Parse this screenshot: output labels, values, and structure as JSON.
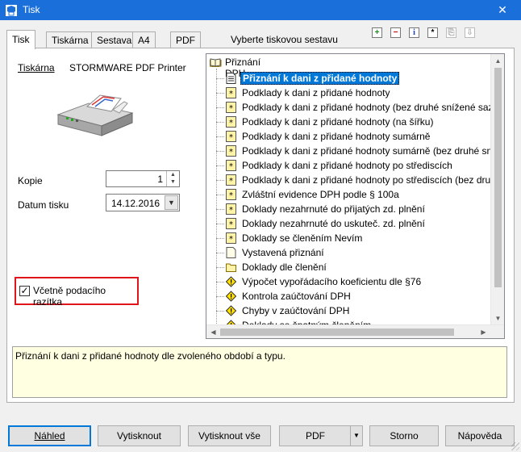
{
  "window": {
    "title": "Tisk",
    "close_glyph": "✕"
  },
  "tabs": [
    {
      "label": "Tisk",
      "active": true
    },
    {
      "label": "Tiskárna",
      "active": false
    },
    {
      "label": "Sestava",
      "active": false
    },
    {
      "label": "A4",
      "active": false
    },
    {
      "label": "PDF",
      "active": false
    }
  ],
  "tree_header_label": "Vyberte tiskovou sestavu",
  "toolbar_icons": [
    "plus-icon",
    "minus-icon",
    "info-icon",
    "star-icon",
    "copy-icon",
    "move-down-icon"
  ],
  "toolbar_glyphs": {
    "plus": "+",
    "minus": "−",
    "info": "i",
    "star": "*",
    "copy": "⎘",
    "down": "⇩"
  },
  "left": {
    "printer_label": "Tiskárna",
    "printer_value": "STORMWARE PDF Printer",
    "copies_label": "Kopie",
    "copies_value": "1",
    "date_label": "Datum tisku",
    "date_value": "14.12.2016",
    "stamp_label": "Včetně podacího razítka",
    "stamp_checked": true
  },
  "tree": {
    "root_label": "Přiznání DPH",
    "items": [
      {
        "label": "Přiznání k dani z přidané hodnoty",
        "icon": "document-icon",
        "selected": true
      },
      {
        "label": "Podklady k dani z přidané hodnoty",
        "icon": "star-doc-icon"
      },
      {
        "label": "Podklady k dani z přidané hodnoty (bez druhé snížené sazby)",
        "icon": "star-doc-icon"
      },
      {
        "label": "Podklady k dani z přidané hodnoty (na šířku)",
        "icon": "star-doc-icon"
      },
      {
        "label": "Podklady k dani z přidané hodnoty sumárně",
        "icon": "star-doc-icon"
      },
      {
        "label": "Podklady k dani z přidané hodnoty sumárně (bez druhé snížené sazby)",
        "icon": "star-doc-icon"
      },
      {
        "label": "Podklady k dani z přidané hodnoty po střediscích",
        "icon": "star-doc-icon"
      },
      {
        "label": "Podklady k dani z přidané hodnoty po střediscích (bez druhé snížené sazby)",
        "icon": "star-doc-icon"
      },
      {
        "label": "Zvláštní evidence DPH podle § 100a",
        "icon": "star-doc-icon"
      },
      {
        "label": "Doklady nezahrnuté do přijatých zd. plnění",
        "icon": "star-doc-icon"
      },
      {
        "label": "Doklady nezahrnuté do uskuteč. zd. plnění",
        "icon": "star-doc-icon"
      },
      {
        "label": "Doklady se členěním Nevím",
        "icon": "star-doc-icon"
      },
      {
        "label": "Vystavená přiznání",
        "icon": "plain-doc-icon"
      },
      {
        "label": "Doklady dle členění",
        "icon": "folder-icon"
      },
      {
        "label": "Výpočet vypořádacího koeficientu dle §76",
        "icon": "warning-icon"
      },
      {
        "label": "Kontrola zaúčtování DPH",
        "icon": "warning-icon"
      },
      {
        "label": "Chyby v zaúčtování DPH",
        "icon": "warning-icon"
      },
      {
        "label": "Doklady se špatným členěním",
        "icon": "warning-icon"
      }
    ]
  },
  "description": "Přiznání k dani z přidané hodnoty dle zvoleného období a typu.",
  "buttons": {
    "preview": "Náhled",
    "print": "Vytisknout",
    "print_all": "Vytisknout vše",
    "pdf": "PDF",
    "cancel": "Storno",
    "help": "Nápověda"
  },
  "colors": {
    "titlebar": "#1a6fdb",
    "selection": "#0078d7",
    "highlight_frame": "#e0151b",
    "description_bg": "#ffffe1"
  }
}
